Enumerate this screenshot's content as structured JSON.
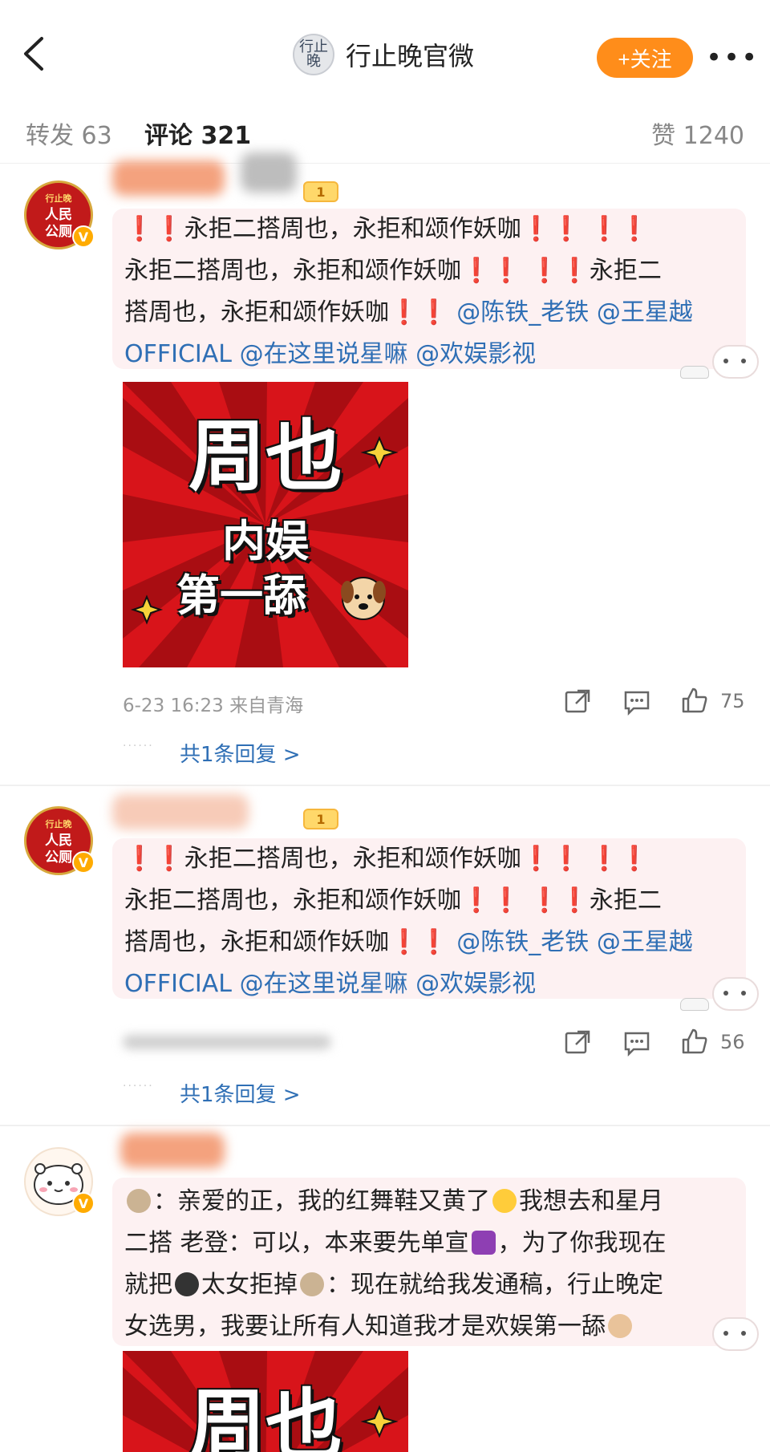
{
  "header": {
    "back_icon": "chevron-left-icon",
    "avatar_text": "行止晚",
    "title": "行止晚官微",
    "follow_label": "+关注",
    "more_icon": "more-dots-icon"
  },
  "tabs": {
    "repost": "转发 63",
    "comment": "评论 321",
    "like": "赞 1240"
  },
  "comments": [
    {
      "avatar_text": [
        "行止晚",
        "人民",
        "公厕"
      ],
      "verified_badge": "V",
      "level": "1",
      "text_parts": {
        "seg1": "永拒二搭周也，永拒和颂作妖咖",
        "seg2": "永拒二搭周也，永拒和颂作妖咖",
        "seg3": "永拒二",
        "seg4": "搭周也，永拒和颂作妖咖",
        "mention1": "@陈铁_老铁",
        "mention2": "@王星越OFFICIAL",
        "mention3": "@在这里说星嘛",
        "mention4": "@欢娱影视"
      },
      "image": {
        "line1": "周也",
        "line2": "内娱",
        "line3": "第一舔"
      },
      "timestamp": "6-23 16:23 来自青海",
      "likes": "75",
      "reply_link": "共1条回复 >"
    },
    {
      "avatar_text": [
        "行止晚",
        "人民",
        "公厕"
      ],
      "verified_badge": "V",
      "level": "1",
      "text_parts": {
        "seg1": "永拒二搭周也，永拒和颂作妖咖",
        "seg2": "永拒二搭周也，永拒和颂作妖咖",
        "seg3": "永拒二",
        "seg4": "搭周也，永拒和颂作妖咖",
        "mention1": "@陈铁_老铁",
        "mention2": "@王星越OFFICIAL",
        "mention3": "@在这里说星嘛",
        "mention4": "@欢娱影视"
      },
      "likes": "56",
      "reply_link": "共1条回复 >"
    },
    {
      "verified_badge": "V",
      "text_parts": {
        "l1a": "：亲爱的正，我的红舞鞋又黄了",
        "l1b": "我想去和星月",
        "l2a": "二搭 老登：可以，本来要先单宣",
        "l2b": "，为了你我现在",
        "l3a": "就把",
        "l3b": "太女拒掉",
        "l3c": "：现在就给我发通稿，行止晚定",
        "l4": "女选男，我要让所有人知道我才是欢娱第一舔"
      },
      "image": {
        "line1": "周也"
      }
    }
  ],
  "colors": {
    "accent_orange": "#ff8d1a",
    "mention_blue": "#2f6fb5",
    "exclamation_red": "#e0191e",
    "bubble_pink": "#fdf1f2",
    "image_red": "#d8141a"
  }
}
